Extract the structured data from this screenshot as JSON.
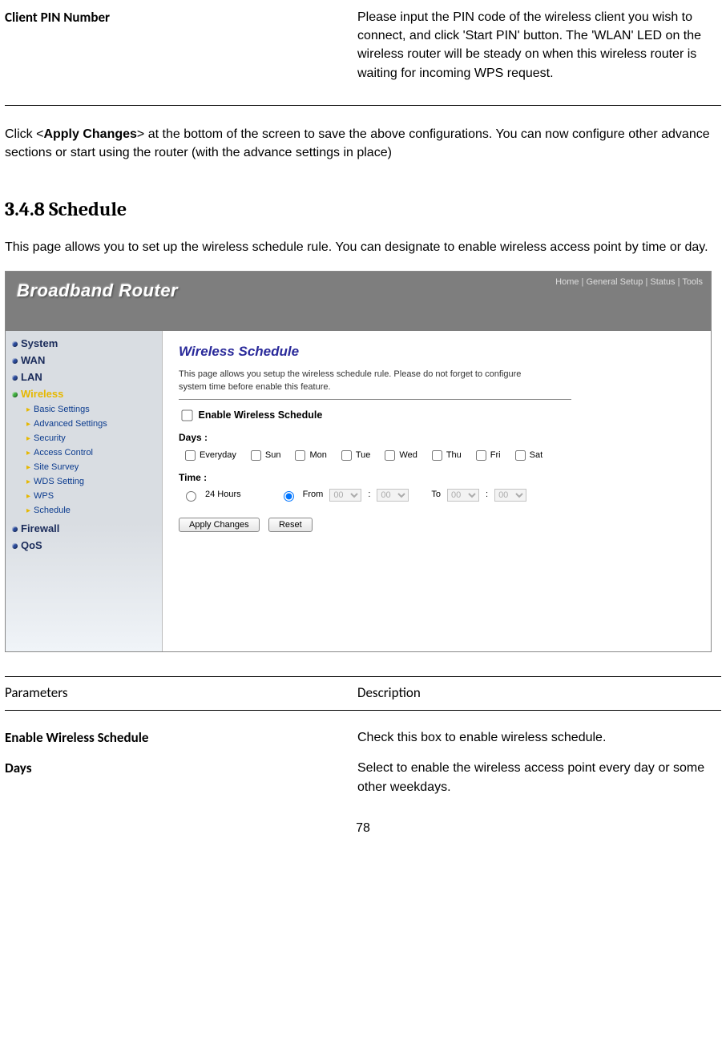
{
  "topRow": {
    "param": "Client PIN Number",
    "desc": "Please input the PIN code of the wireless client you wish to connect, and click 'Start PIN' button. The 'WLAN' LED on the wireless router will be steady on when this wireless router is waiting for incoming WPS request."
  },
  "applyNote": {
    "prefix": "Click <",
    "bold": "Apply Changes",
    "suffix": "> at the bottom of the screen to save the above configurations. You can now configure other advance sections or start using the router (with the advance settings in place)"
  },
  "section": {
    "heading": "3.4.8 Schedule",
    "intro": "This page allows you to set up the wireless schedule rule. You can designate to enable wireless access point by time or day."
  },
  "router": {
    "brand": "Broadband Router",
    "topLinks": "Home | General Setup | Status | Tools",
    "nav": {
      "main": [
        "System",
        "WAN",
        "LAN",
        "Wireless",
        "Firewall",
        "QoS"
      ],
      "wirelessSub": [
        "Basic Settings",
        "Advanced Settings",
        "Security",
        "Access Control",
        "Site Survey",
        "WDS Setting",
        "WPS",
        "Schedule"
      ]
    },
    "panel": {
      "title": "Wireless Schedule",
      "desc": "This page allows you setup the wireless schedule rule. Please do not forget to configure system time before enable this feature.",
      "enableLabel": "Enable Wireless Schedule",
      "daysLabel": "Days :",
      "days": [
        "Everyday",
        "Sun",
        "Mon",
        "Tue",
        "Wed",
        "Thu",
        "Fri",
        "Sat"
      ],
      "timeLabel": "Time :",
      "time24": "24 Hours",
      "timeFrom": "From",
      "timeTo": "To",
      "selVal": "00",
      "btnApply": "Apply Changes",
      "btnReset": "Reset"
    }
  },
  "tableHeader": {
    "param": "Parameters",
    "desc": "Description"
  },
  "rows": {
    "r1": {
      "param": "Enable Wireless Schedule",
      "desc": "Check this box to enable wireless schedule."
    },
    "r2": {
      "param": "Days",
      "desc": "Select to enable the wireless access point every day or some other weekdays."
    }
  },
  "pageNumber": "78"
}
